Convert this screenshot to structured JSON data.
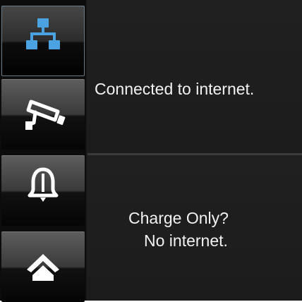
{
  "sidebar": {
    "items": [
      {
        "id": "network",
        "icon": "network-icon",
        "selected": true,
        "icon_color": "#4aa3e0"
      },
      {
        "id": "camera",
        "icon": "security-camera-icon",
        "selected": false,
        "icon_color": "#ffffff"
      },
      {
        "id": "alarm",
        "icon": "bell-icon",
        "selected": false,
        "icon_color": "#ffffff"
      },
      {
        "id": "home",
        "icon": "home-icon",
        "selected": false,
        "icon_color": "#ffffff"
      }
    ]
  },
  "status": {
    "connected_text": "Connected to internet.",
    "charge_line1": "Charge Only?",
    "charge_line2": "No internet."
  },
  "colors": {
    "background": "#1b1b1b",
    "text": "#f2f2f2",
    "accent": "#4aa3e0"
  }
}
